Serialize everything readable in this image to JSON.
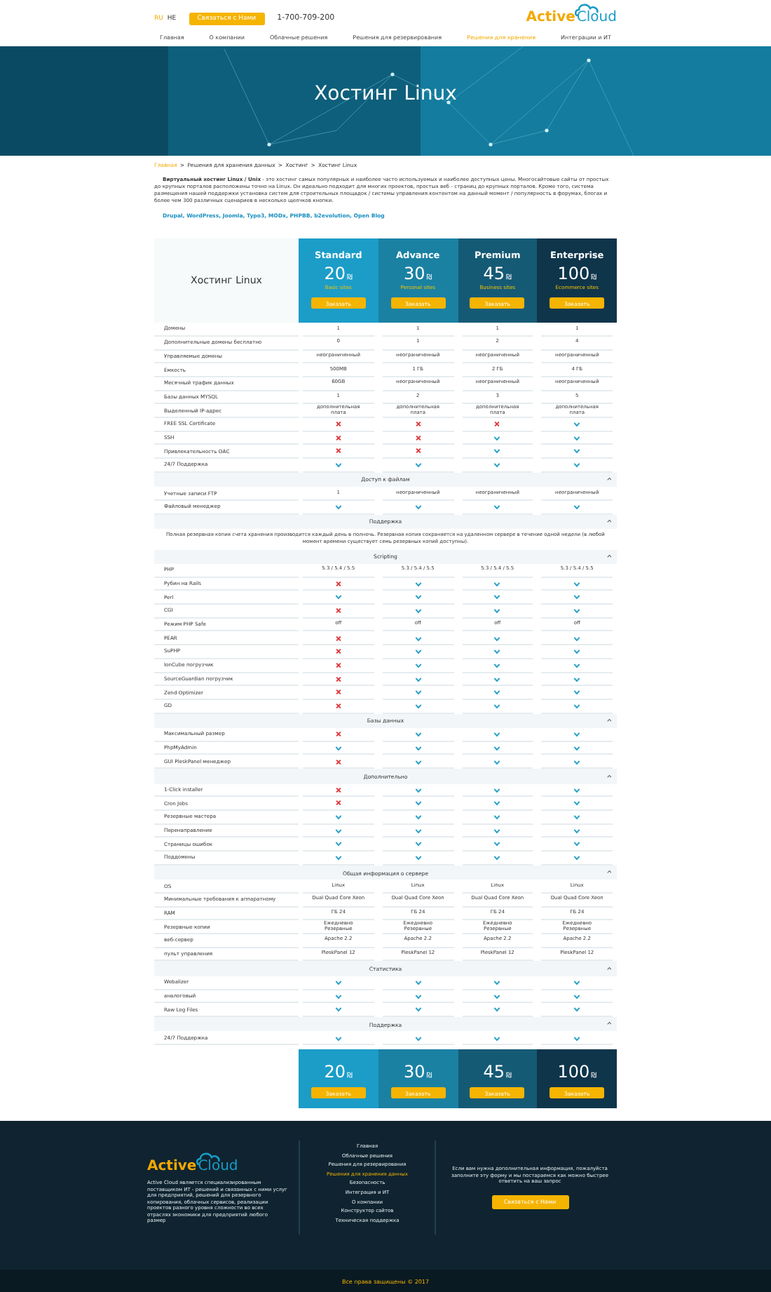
{
  "header": {
    "languages": [
      {
        "label": "RU",
        "selected": true
      },
      {
        "label": "HE",
        "selected": false
      }
    ],
    "contact_button": "Связаться с Нами",
    "phone": "1-700-709-200",
    "logo": {
      "first": "Active",
      "second": "Cloud"
    }
  },
  "nav": [
    {
      "label": "Главная",
      "selected": false
    },
    {
      "label": "О компании",
      "selected": false
    },
    {
      "label": "Облачные решения",
      "selected": false
    },
    {
      "label": "Решения для резервирования",
      "selected": false
    },
    {
      "label": "Решения для хранения",
      "selected": true
    },
    {
      "label": "Интеграции и ИТ",
      "selected": false
    }
  ],
  "banner": {
    "title": "Хостинг Linux"
  },
  "breadcrumb": {
    "separator": ">",
    "items": [
      {
        "label": "Главная",
        "kind": "link"
      },
      {
        "label": "Решения для хранения данных",
        "kind": "text"
      },
      {
        "label": "Хостинг",
        "kind": "text"
      },
      {
        "label": "Хостинг Linux",
        "kind": "text"
      }
    ]
  },
  "intro": {
    "text": "**Виртуальный хостинг Linux / Unix** - это хостинг самых популярных и наиболее часто используемых и наиболее доступных цены. Многосайтовые сайты от простых до крупных порталов расположены точно на Linux. Он идеально подходит для многих проектов, простых веб - страниц до крупных порталов. Кроме того, система размещения нашей поддержки установка систем для строительных площадок / системы управления контентом на данный момент / популярность в форумах, блогах и более чем 300 различных сценариев в несколько щелчков кнопки.",
    "links": "Drupal, WordPress, Joomla, Typo3, MODx, PHPBB, b2evolution, Open Blog"
  },
  "pricing": {
    "title": "Хостинг Linux",
    "plans": [
      {
        "name": "Standard",
        "price": "20",
        "currency": "₪",
        "subtitle": "Basic sites",
        "button": "Заказать",
        "color": "#1b9dc8"
      },
      {
        "name": "Advance",
        "price": "30",
        "currency": "₪",
        "subtitle": "Personal sites",
        "button": "Заказать",
        "color": "#1a81a3"
      },
      {
        "name": "Premium",
        "price": "45",
        "currency": "₪",
        "subtitle": "Business sites",
        "button": "Заказать",
        "color": "#155a75"
      },
      {
        "name": "Enterprise",
        "price": "100",
        "currency": "₪",
        "subtitle": "Ecommerce sites",
        "button": "Заказать",
        "color": "#0f354b"
      }
    ],
    "sections": [
      {
        "rows": [
          {
            "label": "Домены",
            "cells": [
              {
                "kind": "text",
                "text": "1"
              },
              {
                "kind": "text",
                "text": "1"
              },
              {
                "kind": "text",
                "text": "1"
              },
              {
                "kind": "text",
                "text": "1"
              }
            ]
          },
          {
            "label": "Дополнительные домены бесплатно",
            "cells": [
              {
                "kind": "text",
                "text": "0"
              },
              {
                "kind": "text",
                "text": "1"
              },
              {
                "kind": "text",
                "text": "2"
              },
              {
                "kind": "text",
                "text": "4"
              }
            ]
          },
          {
            "label": "Управляемые домены",
            "cells": [
              {
                "kind": "text",
                "text": "неограниченный"
              },
              {
                "kind": "text",
                "text": "неограниченный"
              },
              {
                "kind": "text",
                "text": "неограниченный"
              },
              {
                "kind": "text",
                "text": "неограниченный"
              }
            ]
          },
          {
            "label": "Емкость",
            "cells": [
              {
                "kind": "text",
                "text": "500MB"
              },
              {
                "kind": "text",
                "text": "1 ГБ"
              },
              {
                "kind": "text",
                "text": "2 ГБ"
              },
              {
                "kind": "text",
                "text": "4 ГБ"
              }
            ]
          },
          {
            "label": "Месячный трафик данных",
            "cells": [
              {
                "kind": "text",
                "text": "60GB"
              },
              {
                "kind": "text",
                "text": "неограниченный"
              },
              {
                "kind": "text",
                "text": "неограниченный"
              },
              {
                "kind": "text",
                "text": "неограниченный"
              }
            ]
          },
          {
            "label": "Базы данных MYSQL",
            "cells": [
              {
                "kind": "text",
                "text": "1"
              },
              {
                "kind": "text",
                "text": "2"
              },
              {
                "kind": "text",
                "text": "3"
              },
              {
                "kind": "text",
                "text": "5"
              }
            ]
          },
          {
            "label": "Выделенный IP-адрес",
            "cells": [
              {
                "kind": "text",
                "text": "дополнительная плата"
              },
              {
                "kind": "text",
                "text": "дополнительная плата"
              },
              {
                "kind": "text",
                "text": "дополнительная плата"
              },
              {
                "kind": "text",
                "text": "дополнительная плата"
              }
            ]
          },
          {
            "label": "FREE SSL Certificate",
            "cells": [
              {
                "kind": "cross"
              },
              {
                "kind": "cross"
              },
              {
                "kind": "cross"
              },
              {
                "kind": "check"
              }
            ]
          },
          {
            "label": "SSH",
            "cells": [
              {
                "kind": "cross"
              },
              {
                "kind": "cross"
              },
              {
                "kind": "check"
              },
              {
                "kind": "check"
              }
            ]
          },
          {
            "label": "Привлекательность ОАС",
            "cells": [
              {
                "kind": "cross"
              },
              {
                "kind": "cross"
              },
              {
                "kind": "check"
              },
              {
                "kind": "check"
              }
            ]
          },
          {
            "label": "24/7 Поддержка",
            "cells": [
              {
                "kind": "check"
              },
              {
                "kind": "check"
              },
              {
                "kind": "check"
              },
              {
                "kind": "check"
              }
            ]
          }
        ]
      },
      {
        "title": "Доступ к файлам",
        "expanded": true,
        "rows": [
          {
            "label": "Учетные записи FTP",
            "cells": [
              {
                "kind": "text",
                "text": "1"
              },
              {
                "kind": "text",
                "text": "неограниченный"
              },
              {
                "kind": "text",
                "text": "неограниченный"
              },
              {
                "kind": "text",
                "text": "неограниченный"
              }
            ]
          },
          {
            "label": "Файловый менеджер",
            "cells": [
              {
                "kind": "check"
              },
              {
                "kind": "check"
              },
              {
                "kind": "check"
              },
              {
                "kind": "check"
              }
            ]
          }
        ]
      },
      {
        "title": "Поддержка",
        "expanded": true,
        "note": "Полная резервная копия счета хранения производится каждый день в полночь. Резервная копия сохраняется на удаленном сервере в течение одной недели (в любой момент времени существует семь резервных копий доступны)."
      },
      {
        "title": "Scripting",
        "expanded": true,
        "rows": [
          {
            "label": "PHP",
            "cells": [
              {
                "kind": "text",
                "text": "5.3 / 5.4 / 5.5"
              },
              {
                "kind": "text",
                "text": "5.3 / 5.4 / 5.5"
              },
              {
                "kind": "text",
                "text": "5.3 / 5.4 / 5.5"
              },
              {
                "kind": "text",
                "text": "5.3 / 5.4 / 5.5"
              }
            ]
          },
          {
            "label": "Рубин на Rails",
            "cells": [
              {
                "kind": "cross"
              },
              {
                "kind": "check"
              },
              {
                "kind": "check"
              },
              {
                "kind": "check"
              }
            ]
          },
          {
            "label": "Perl",
            "cells": [
              {
                "kind": "check"
              },
              {
                "kind": "check"
              },
              {
                "kind": "check"
              },
              {
                "kind": "check"
              }
            ]
          },
          {
            "label": "CGI",
            "cells": [
              {
                "kind": "cross"
              },
              {
                "kind": "check"
              },
              {
                "kind": "check"
              },
              {
                "kind": "check"
              }
            ]
          },
          {
            "label": "Режим PHP Safe",
            "cells": [
              {
                "kind": "text",
                "text": "off"
              },
              {
                "kind": "text",
                "text": "off"
              },
              {
                "kind": "text",
                "text": "off"
              },
              {
                "kind": "text",
                "text": "off"
              }
            ]
          },
          {
            "label": "PEAR",
            "cells": [
              {
                "kind": "cross"
              },
              {
                "kind": "check"
              },
              {
                "kind": "check"
              },
              {
                "kind": "check"
              }
            ]
          },
          {
            "label": "SuPHP",
            "cells": [
              {
                "kind": "cross"
              },
              {
                "kind": "check"
              },
              {
                "kind": "check"
              },
              {
                "kind": "check"
              }
            ]
          },
          {
            "label": "IonCube погрузчик",
            "cells": [
              {
                "kind": "cross"
              },
              {
                "kind": "check"
              },
              {
                "kind": "check"
              },
              {
                "kind": "check"
              }
            ]
          },
          {
            "label": "SourceGuardian погрузчик",
            "cells": [
              {
                "kind": "cross"
              },
              {
                "kind": "check"
              },
              {
                "kind": "check"
              },
              {
                "kind": "check"
              }
            ]
          },
          {
            "label": "Zend Optimizer",
            "cells": [
              {
                "kind": "cross"
              },
              {
                "kind": "check"
              },
              {
                "kind": "check"
              },
              {
                "kind": "check"
              }
            ]
          },
          {
            "label": "GD",
            "cells": [
              {
                "kind": "cross"
              },
              {
                "kind": "check"
              },
              {
                "kind": "check"
              },
              {
                "kind": "check"
              }
            ]
          }
        ]
      },
      {
        "title": "Базы данных",
        "expanded": true,
        "rows": [
          {
            "label": "Максимальный размер",
            "cells": [
              {
                "kind": "cross"
              },
              {
                "kind": "check"
              },
              {
                "kind": "check"
              },
              {
                "kind": "check"
              }
            ]
          },
          {
            "label": "PhpMyAdmin",
            "cells": [
              {
                "kind": "check"
              },
              {
                "kind": "check"
              },
              {
                "kind": "check"
              },
              {
                "kind": "check"
              }
            ]
          },
          {
            "label": "GUI PleskPanel менеджер",
            "cells": [
              {
                "kind": "cross"
              },
              {
                "kind": "check"
              },
              {
                "kind": "check"
              },
              {
                "kind": "check"
              }
            ]
          }
        ]
      },
      {
        "title": "Дополнительно",
        "expanded": true,
        "rows": [
          {
            "label": "1-Click installer",
            "cells": [
              {
                "kind": "cross"
              },
              {
                "kind": "check"
              },
              {
                "kind": "check"
              },
              {
                "kind": "check"
              }
            ]
          },
          {
            "label": "Cron Jobs",
            "cells": [
              {
                "kind": "cross"
              },
              {
                "kind": "check"
              },
              {
                "kind": "check"
              },
              {
                "kind": "check"
              }
            ]
          },
          {
            "label": "Резервные мастера",
            "cells": [
              {
                "kind": "check"
              },
              {
                "kind": "check"
              },
              {
                "kind": "check"
              },
              {
                "kind": "check"
              }
            ]
          },
          {
            "label": "Перенаправление",
            "cells": [
              {
                "kind": "check"
              },
              {
                "kind": "check"
              },
              {
                "kind": "check"
              },
              {
                "kind": "check"
              }
            ]
          },
          {
            "label": "Страницы ошибок",
            "cells": [
              {
                "kind": "check"
              },
              {
                "kind": "check"
              },
              {
                "kind": "check"
              },
              {
                "kind": "check"
              }
            ]
          },
          {
            "label": "Поддомены",
            "cells": [
              {
                "kind": "check"
              },
              {
                "kind": "check"
              },
              {
                "kind": "check"
              },
              {
                "kind": "check"
              }
            ]
          }
        ]
      },
      {
        "title": "Общая информация о сервере",
        "expanded": true,
        "rows": [
          {
            "label": "OS",
            "cells": [
              {
                "kind": "text",
                "text": "Linux"
              },
              {
                "kind": "text",
                "text": "Linux"
              },
              {
                "kind": "text",
                "text": "Linux"
              },
              {
                "kind": "text",
                "text": "Linux"
              }
            ]
          },
          {
            "label": "Минимальные требования к аппаратному",
            "cells": [
              {
                "kind": "text",
                "text": "Dual Quad Core Xeon"
              },
              {
                "kind": "text",
                "text": "Dual Quad Core Xeon"
              },
              {
                "kind": "text",
                "text": "Dual Quad Core Xeon"
              },
              {
                "kind": "text",
                "text": "Dual Quad Core Xeon"
              }
            ]
          },
          {
            "label": "RAM",
            "cells": [
              {
                "kind": "text",
                "text": "ГБ 24"
              },
              {
                "kind": "text",
                "text": "ГБ 24"
              },
              {
                "kind": "text",
                "text": "ГБ 24"
              },
              {
                "kind": "text",
                "text": "ГБ 24"
              }
            ]
          },
          {
            "label": "Резервные копии",
            "cells": [
              {
                "kind": "text",
                "text": "Ежедневно Резервные"
              },
              {
                "kind": "text",
                "text": "Ежедневно Резервные"
              },
              {
                "kind": "text",
                "text": "Ежедневно Резервные"
              },
              {
                "kind": "text",
                "text": "Ежедневно Резервные"
              }
            ]
          },
          {
            "label": "веб-сервер",
            "cells": [
              {
                "kind": "text",
                "text": "Apache 2.2"
              },
              {
                "kind": "text",
                "text": "Apache 2.2"
              },
              {
                "kind": "text",
                "text": "Apache 2.2"
              },
              {
                "kind": "text",
                "text": "Apache 2.2"
              }
            ]
          },
          {
            "label": "пульт управления",
            "cells": [
              {
                "kind": "text",
                "text": "PleskPanel 12"
              },
              {
                "kind": "text",
                "text": "PleskPanel 12"
              },
              {
                "kind": "text",
                "text": "PleskPanel 12"
              },
              {
                "kind": "text",
                "text": "PleskPanel 12"
              }
            ]
          }
        ]
      },
      {
        "title": "Статистика",
        "expanded": true,
        "rows": [
          {
            "label": "Webalizer",
            "cells": [
              {
                "kind": "check"
              },
              {
                "kind": "check"
              },
              {
                "kind": "check"
              },
              {
                "kind": "check"
              }
            ]
          },
          {
            "label": "аналоговый",
            "cells": [
              {
                "kind": "check"
              },
              {
                "kind": "check"
              },
              {
                "kind": "check"
              },
              {
                "kind": "check"
              }
            ]
          },
          {
            "label": "Raw Log Files",
            "cells": [
              {
                "kind": "check"
              },
              {
                "kind": "check"
              },
              {
                "kind": "check"
              },
              {
                "kind": "check"
              }
            ]
          }
        ]
      },
      {
        "title": "Поддержка",
        "expanded": true,
        "rows": [
          {
            "label": "24/7 Поддержка",
            "cells": [
              {
                "kind": "check"
              },
              {
                "kind": "check"
              },
              {
                "kind": "check"
              },
              {
                "kind": "check"
              }
            ]
          }
        ]
      }
    ],
    "bottom": [
      {
        "price": "20",
        "currency": "₪",
        "button": "Заказать"
      },
      {
        "price": "30",
        "currency": "₪",
        "button": "Заказать"
      },
      {
        "price": "45",
        "currency": "₪",
        "button": "Заказать"
      },
      {
        "price": "100",
        "currency": "₪",
        "button": "Заказать"
      }
    ]
  },
  "footer": {
    "logo": {
      "first": "Active",
      "second": "Cloud"
    },
    "about": "Active Cloud является специализированным поставщиком ИТ - решений и связанных с ними услуг для предприятий, решений для резервного копирования, облачных сервисов, реализации проектов разного уровня сложности во всех отраслях экономики для предприятий любого размер",
    "links": [
      {
        "label": "Главная",
        "selected": false
      },
      {
        "label": "Облачные решения",
        "selected": false
      },
      {
        "label": "Решения для резервирования",
        "selected": false
      },
      {
        "label": "Решения для хранения данных",
        "selected": true
      },
      {
        "label": "Безопасность",
        "selected": false
      },
      {
        "label": "Интеграция и ИТ",
        "selected": false
      },
      {
        "label": "О компании",
        "selected": false
      },
      {
        "label": "Конструктор сайтов",
        "selected": false
      },
      {
        "label": "Техническая поддержка",
        "selected": false
      }
    ],
    "contact_text": "Если вам нужна дополнительная информация, пожалуйста заполните эту форму и мы постараемся как можно быстрее ответить на ваш запрос",
    "contact_button": "Связаться с Нами",
    "copyright": "Все права защищены © 2017"
  }
}
